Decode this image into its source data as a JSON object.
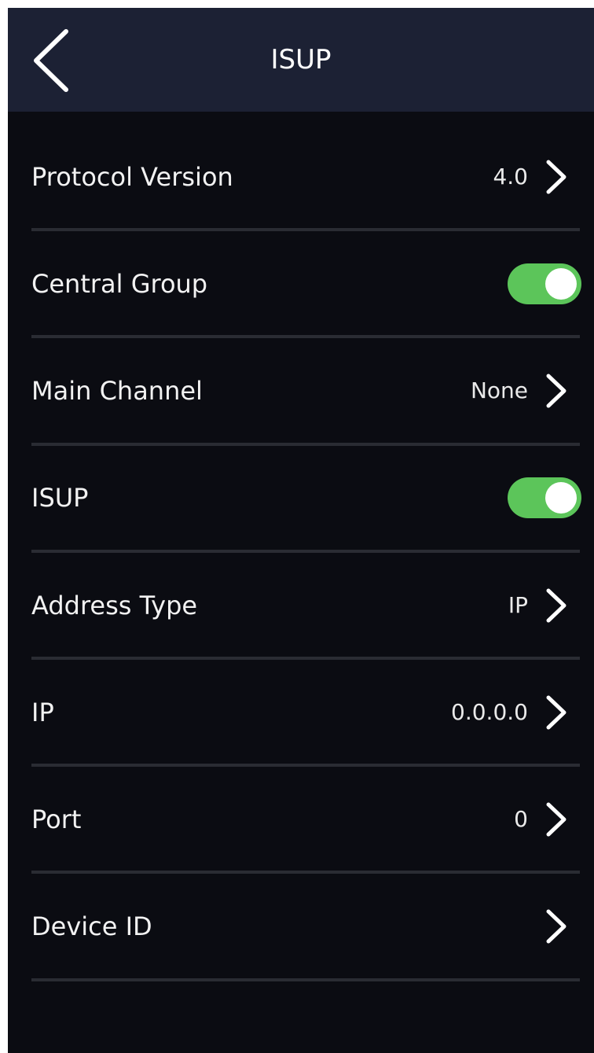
{
  "header": {
    "title": "ISUP",
    "back_icon": "chevron-left-icon"
  },
  "settings": {
    "protocol_version": {
      "label": "Protocol Version",
      "value": "4.0"
    },
    "central_group": {
      "label": "Central Group",
      "enabled": true
    },
    "main_channel": {
      "label": "Main Channel",
      "value": "None"
    },
    "isup": {
      "label": "ISUP",
      "enabled": true
    },
    "address_type": {
      "label": "Address Type",
      "value": "IP"
    },
    "ip": {
      "label": "IP",
      "value": "0.0.0.0"
    },
    "port": {
      "label": "Port",
      "value": "0"
    },
    "device_id": {
      "label": "Device ID",
      "value": ""
    }
  },
  "colors": {
    "header_bg": "#1c2134",
    "background": "#0b0c12",
    "toggle_on": "#5cc55a",
    "divider": "#2a2c33"
  }
}
